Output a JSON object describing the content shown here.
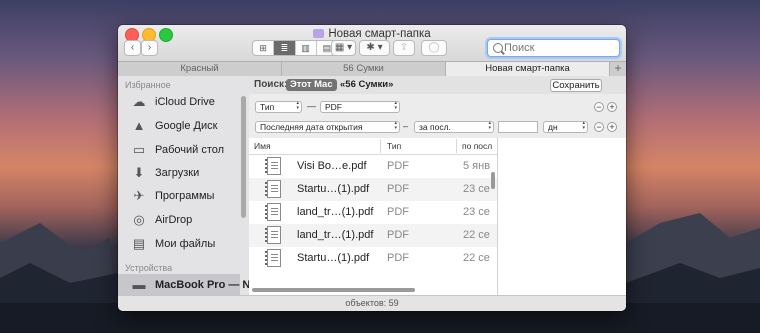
{
  "window": {
    "title": "Новая смарт-папка"
  },
  "toolbar": {
    "back_label": "‹",
    "forward_label": "›",
    "views": [
      "⊞",
      "≣",
      "▥",
      "▤"
    ],
    "arrange_label": "▦ ▾",
    "action_label": "✱ ▾",
    "share_label": "⇪",
    "tag_label": "◯",
    "search_placeholder": "Поиск"
  },
  "tabs": [
    {
      "label": "Красный"
    },
    {
      "label": "56 Сумки"
    },
    {
      "label": "Новая смарт-папка"
    }
  ],
  "tab_add_label": "+",
  "sidebar": {
    "favorites_header": "Избранное",
    "favorites": [
      {
        "label": "iCloud Drive",
        "icon": "☁"
      },
      {
        "label": "Google Диск",
        "icon": "▲"
      },
      {
        "label": "Рабочий стол",
        "icon": "▭"
      },
      {
        "label": "Загрузки",
        "icon": "⬇"
      },
      {
        "label": "Программы",
        "icon": "✈"
      },
      {
        "label": "AirDrop",
        "icon": "◎"
      },
      {
        "label": "Мои файлы",
        "icon": "▤"
      }
    ],
    "devices_header": "Устройства",
    "devices": [
      {
        "label": "MacBook Pro — N…",
        "icon": "▬"
      }
    ]
  },
  "search_bar": {
    "label": "Поиск:",
    "scope_this_mac": "Этот Mac",
    "scope_folder": "«56 Сумки»",
    "save_label": "Сохранить"
  },
  "criteria": {
    "row1": {
      "attribute": "Тип",
      "dash": "—",
      "value": "PDF",
      "minus": "−",
      "plus": "+"
    },
    "row2": {
      "attribute": "Последняя дата открытия",
      "dash": "–",
      "operator": "за посл.",
      "amount": "",
      "unit": "дн",
      "minus": "−",
      "plus": "+"
    }
  },
  "file_list": {
    "columns": [
      "Имя",
      "Тип",
      "по посл"
    ],
    "rows": [
      {
        "name": "Visi Bo…e.pdf",
        "type": "PDF",
        "date": "5 янв"
      },
      {
        "name": "Startu…(1).pdf",
        "type": "PDF",
        "date": "23 се"
      },
      {
        "name": "land_tr…(1).pdf",
        "type": "PDF",
        "date": "23 се"
      },
      {
        "name": "land_tr…(1).pdf",
        "type": "PDF",
        "date": "22 се"
      },
      {
        "name": "Startu…(1).pdf",
        "type": "PDF",
        "date": "22 се"
      }
    ]
  },
  "status": {
    "text": "объектов: 59"
  }
}
